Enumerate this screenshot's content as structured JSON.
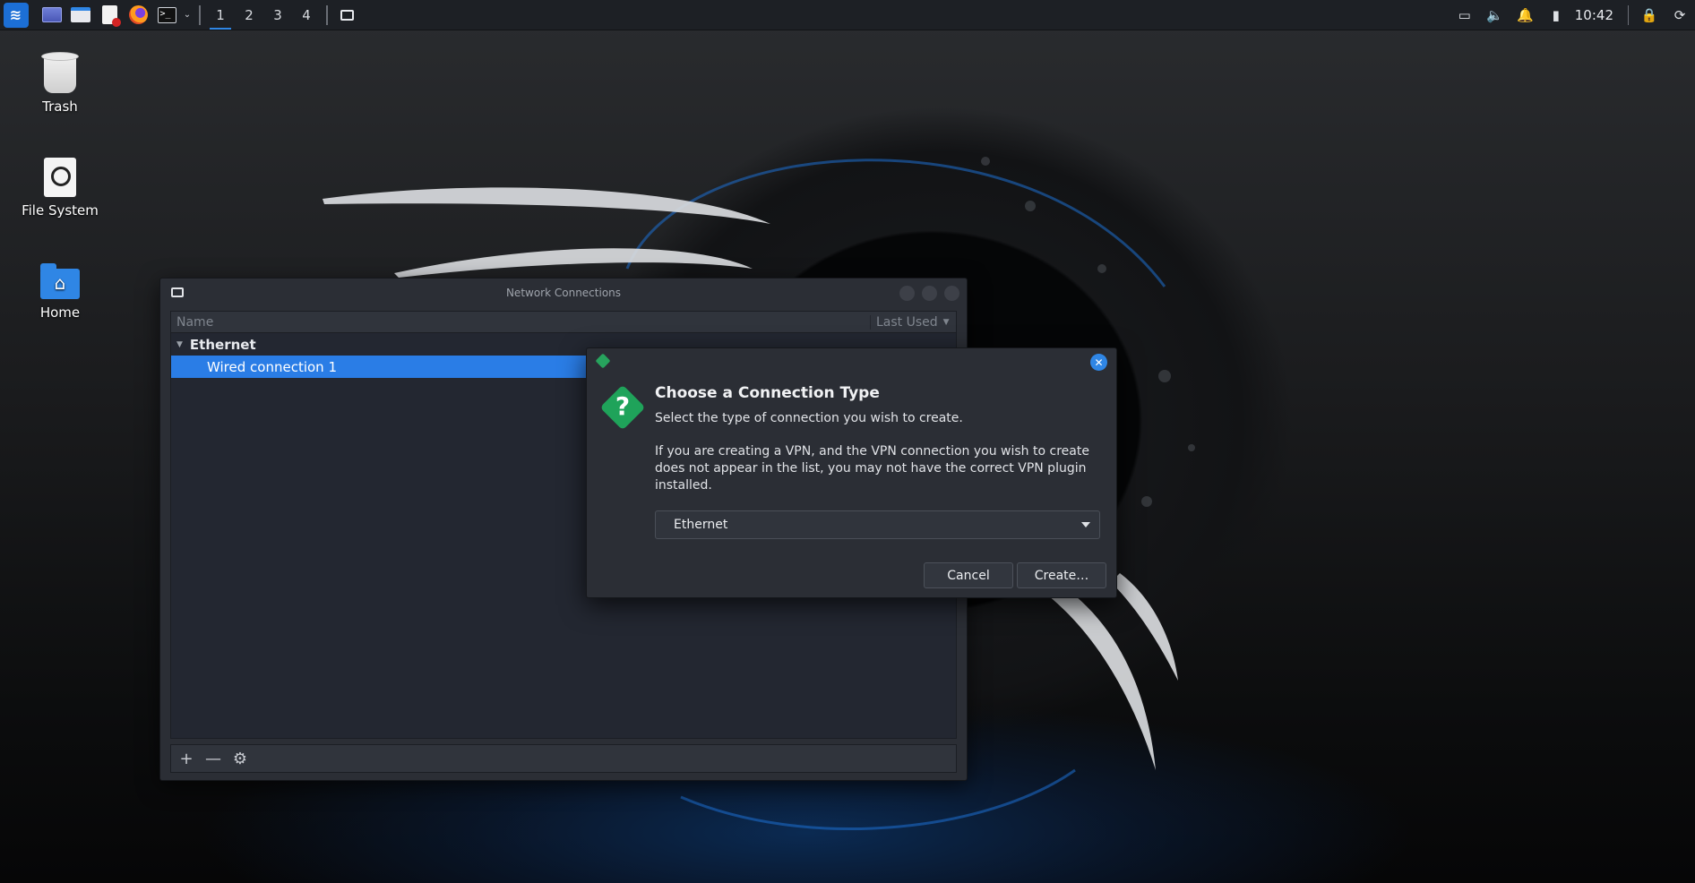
{
  "panel": {
    "workspaces": [
      "1",
      "2",
      "3",
      "4"
    ],
    "active_workspace": "1",
    "clock": "10:42",
    "launchers": [
      "kali-menu-icon",
      "show-desktop-icon",
      "file-manager-icon",
      "text-editor-icon",
      "firefox-icon",
      "terminal-icon"
    ],
    "tray": [
      "display-icon",
      "volume-icon",
      "notification-bell-icon",
      "battery-icon",
      "lock-icon",
      "logout-icon"
    ]
  },
  "desktop": {
    "icons": [
      {
        "label": "Trash",
        "icon": "trash-icon"
      },
      {
        "label": "File System",
        "icon": "drive-icon"
      },
      {
        "label": "Home",
        "icon": "home-folder-icon"
      }
    ]
  },
  "network_window": {
    "title": "Network Connections",
    "columns": {
      "name": "Name",
      "last_used": "Last Used"
    },
    "groups": [
      {
        "name": "Ethernet",
        "connections": [
          "Wired connection 1"
        ]
      }
    ],
    "selected_connection": "Wired connection 1"
  },
  "dialog": {
    "heading": "Choose a Connection Type",
    "subtitle": "Select the type of connection you wish to create.",
    "info": "If you are creating a VPN, and the VPN connection you wish to create does not appear in the list, you may not have the correct VPN plugin installed.",
    "selected_type": "Ethernet",
    "cancel_label": "Cancel",
    "create_label": "Create…"
  },
  "colors": {
    "accent": "#2a7de6",
    "panel": "#1d2025",
    "window": "#2b2e35",
    "question_icon": "#1fa35a"
  }
}
